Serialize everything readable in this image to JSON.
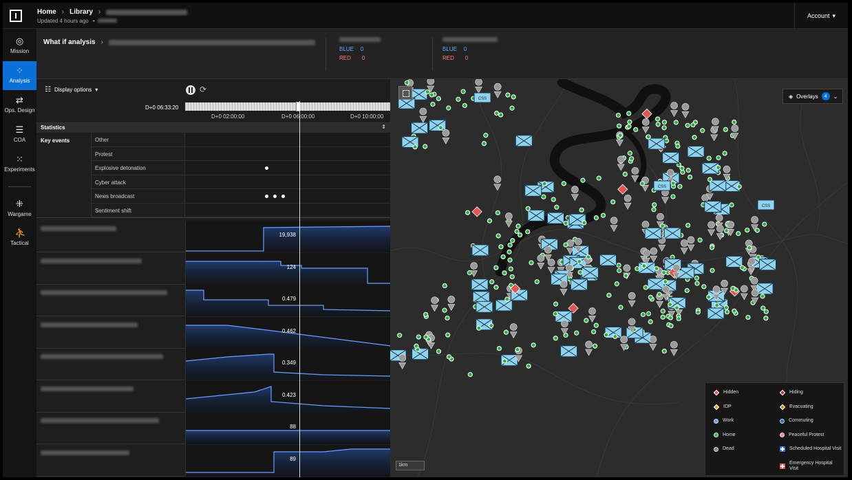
{
  "topbar": {
    "crumb_home": "Home",
    "crumb_library": "Library",
    "updated": "Updated 4 hours ago",
    "account": "Account"
  },
  "nav": [
    {
      "label": "Mission",
      "icon": "compass-icon",
      "glyph": "◎"
    },
    {
      "label": "Analysis",
      "icon": "analysis-icon",
      "glyph": "⁘"
    },
    {
      "label": "Ops. Design",
      "icon": "ops-design-icon",
      "glyph": "⇄"
    },
    {
      "label": "COA",
      "icon": "coa-icon",
      "glyph": "☰"
    },
    {
      "label": "Experiments",
      "icon": "experiments-icon",
      "glyph": "⁙"
    },
    {
      "label": "Wargame",
      "icon": "wargame-icon",
      "glyph": "⁜"
    },
    {
      "label": "Tactical",
      "icon": "tactical-icon",
      "glyph": "⛹"
    }
  ],
  "subheader": {
    "title": "What if analysis",
    "team1": {
      "blue_label": "BLUE",
      "blue_value": "0",
      "red_label": "RED",
      "red_value": "0"
    },
    "team2": {
      "blue_label": "BLUE",
      "blue_value": "0",
      "red_label": "RED",
      "red_value": "0"
    }
  },
  "toolbar": {
    "display_options": "Display options"
  },
  "timeline": {
    "current": "D+0 06:33:20",
    "ticks": [
      "D+0 02:00:00",
      "D+0 06:00:00",
      "D+0 10:00:00"
    ],
    "progress": 0.55
  },
  "statistics": {
    "title": "Statistics",
    "key_events_label": "Key events"
  },
  "key_events": [
    {
      "name": "Other",
      "dots": []
    },
    {
      "name": "Protest",
      "dots": []
    },
    {
      "name": "Explosive detonation",
      "dots": [
        0.39
      ]
    },
    {
      "name": "Cyber attack",
      "dots": []
    },
    {
      "name": "News broadcast",
      "dots": [
        0.39,
        0.43,
        0.47
      ]
    },
    {
      "name": "Sentiment shift",
      "dots": []
    }
  ],
  "metrics": [
    {
      "value": "19,938"
    },
    {
      "value": "124"
    },
    {
      "value": "0.479"
    },
    {
      "value": "0.462"
    },
    {
      "value": "0.349"
    },
    {
      "value": "0.423"
    },
    {
      "value": "88"
    },
    {
      "value": "89"
    }
  ],
  "map": {
    "overlays_label": "Overlays",
    "overlays_count": "4",
    "scale": "1km",
    "unit_label": "CSS",
    "legend": [
      {
        "label": "Hidden",
        "shape": "diamond",
        "color": "#e25555"
      },
      {
        "label": "Hiding",
        "shape": "diamond",
        "color": "#c0392b"
      },
      {
        "label": "IDP",
        "shape": "diamond",
        "color": "#e0a030"
      },
      {
        "label": "Evacuating",
        "shape": "diamond",
        "color": "#c98a1e"
      },
      {
        "label": "Work",
        "shape": "circle",
        "color": "#6b9cff"
      },
      {
        "label": "Commuting",
        "shape": "circle",
        "color": "#2f6fd6"
      },
      {
        "label": "Home",
        "shape": "circle",
        "color": "#3ec15a"
      },
      {
        "label": "Peaceful Protest",
        "shape": "circle",
        "color": "#ff7fb0"
      },
      {
        "label": "Dead",
        "shape": "circle",
        "color": "#8a8a8a"
      },
      {
        "label": "Scheduled Hospital Visit",
        "shape": "cross",
        "color": "#2f6fd6"
      },
      {
        "label": "",
        "shape": "none",
        "color": ""
      },
      {
        "label": "Emergency Hospital Visit",
        "shape": "cross",
        "color": "#e25555"
      }
    ]
  }
}
